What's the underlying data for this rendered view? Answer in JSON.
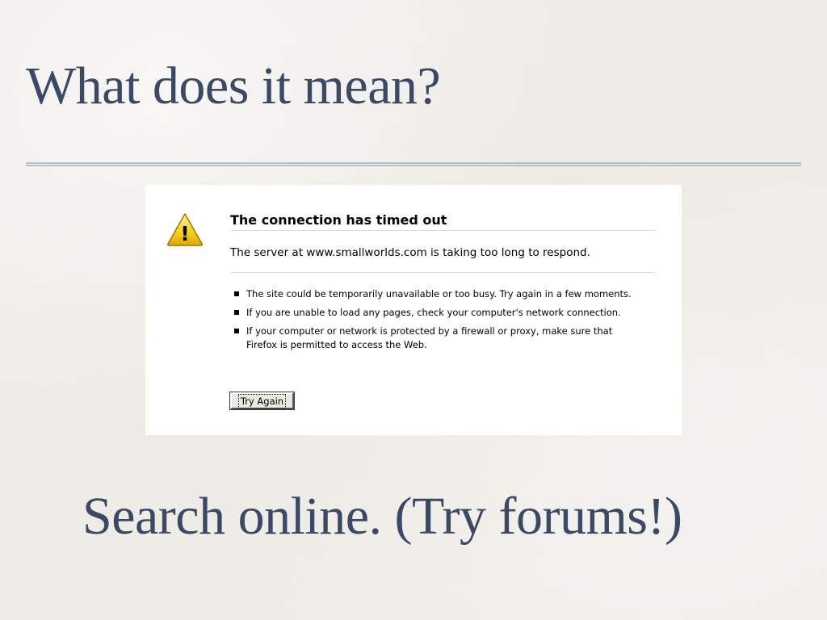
{
  "slide": {
    "title": "What does it mean?",
    "subtitle": "Search online. (Try forums!)",
    "text_color": "#3a4a66",
    "rule_color": "#b3c0d4",
    "background_color": "#efece7"
  },
  "screenshot": {
    "icon": "warning-triangle-icon",
    "icon_symbol": "!",
    "error_title": "The connection has timed out",
    "error_description": "The server at www.smallworlds.com is taking too long to respond.",
    "tips": [
      "The site could be temporarily unavailable or too busy. Try again in a few moments.",
      "If you are unable to load any pages, check your computer's network connection.",
      "If your computer or network is protected by a firewall or proxy, make sure that Firefox is permitted to access the Web."
    ],
    "button_label": "Try Again"
  }
}
